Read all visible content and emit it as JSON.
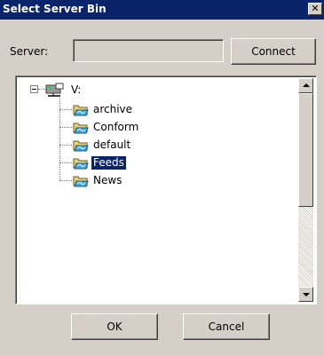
{
  "window": {
    "title": "Select Server Bin"
  },
  "server": {
    "label": "Server:",
    "value": "",
    "connect_label": "Connect"
  },
  "tree": {
    "root": {
      "label": "V:"
    },
    "items": [
      {
        "label": "archive"
      },
      {
        "label": "Conform"
      },
      {
        "label": "default"
      },
      {
        "label": "Feeds",
        "selected": true
      },
      {
        "label": "News"
      }
    ]
  },
  "buttons": {
    "ok": "OK",
    "cancel": "Cancel"
  },
  "colors": {
    "titlebar": "#0a246a",
    "selection": "#0a246a",
    "face": "#d4d0c8"
  },
  "icons": {
    "drive": "network-drive-icon",
    "folder": "folder-icon",
    "close": "close-icon"
  }
}
